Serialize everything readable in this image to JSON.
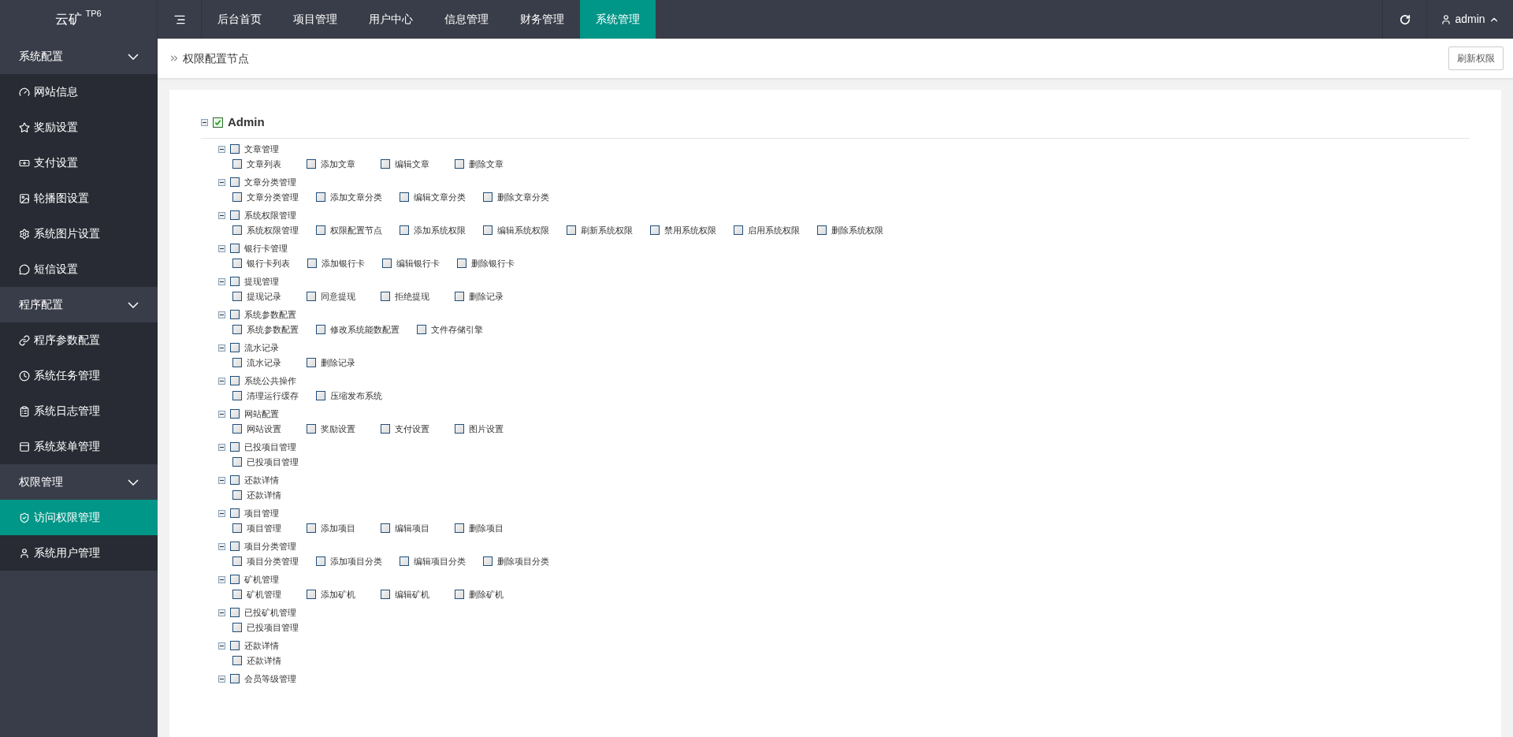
{
  "logo": {
    "name": "云矿",
    "sup": "TP6"
  },
  "top_nav": {
    "tabs": [
      {
        "label": "后台首页",
        "selected": false
      },
      {
        "label": "项目管理",
        "selected": false
      },
      {
        "label": "用户中心",
        "selected": false
      },
      {
        "label": "信息管理",
        "selected": false
      },
      {
        "label": "财务管理",
        "selected": false
      },
      {
        "label": "系统管理",
        "selected": true
      }
    ],
    "user": "admin"
  },
  "sidebar": {
    "sections": [
      {
        "title": "系统配置",
        "expanded": true,
        "items": [
          {
            "label": "网站信息",
            "selected": false
          },
          {
            "label": "奖励设置",
            "selected": false
          },
          {
            "label": "支付设置",
            "selected": false
          },
          {
            "label": "轮播图设置",
            "selected": false
          },
          {
            "label": "系统图片设置",
            "selected": false
          },
          {
            "label": "短信设置",
            "selected": false
          }
        ]
      },
      {
        "title": "程序配置",
        "expanded": true,
        "items": [
          {
            "label": "程序参数配置",
            "selected": false
          },
          {
            "label": "系统任务管理",
            "selected": false
          },
          {
            "label": "系统日志管理",
            "selected": false
          },
          {
            "label": "系统菜单管理",
            "selected": false
          }
        ]
      },
      {
        "title": "权限管理",
        "expanded": true,
        "items": [
          {
            "label": "访问权限管理",
            "selected": true
          },
          {
            "label": "系统用户管理",
            "selected": false
          }
        ]
      }
    ]
  },
  "breadcrumb": "权限配置节点",
  "refresh_button": "刷新权限",
  "tree": {
    "label": "Admin",
    "checked": true,
    "expanded": true,
    "children": [
      {
        "label": "文章管理",
        "checked": false,
        "expanded": true,
        "children": [
          {
            "label": "文章列表",
            "checked": false
          },
          {
            "label": "添加文章",
            "checked": false
          },
          {
            "label": "编辑文章",
            "checked": false
          },
          {
            "label": "删除文章",
            "checked": false
          }
        ]
      },
      {
        "label": "文章分类管理",
        "checked": false,
        "expanded": true,
        "children": [
          {
            "label": "文章分类管理",
            "checked": false
          },
          {
            "label": "添加文章分类",
            "checked": false
          },
          {
            "label": "编辑文章分类",
            "checked": false
          },
          {
            "label": "删除文章分类",
            "checked": false
          }
        ]
      },
      {
        "label": "系统权限管理",
        "checked": false,
        "expanded": true,
        "children": [
          {
            "label": "系统权限管理",
            "checked": false
          },
          {
            "label": "权限配置节点",
            "checked": false
          },
          {
            "label": "添加系统权限",
            "checked": false
          },
          {
            "label": "编辑系统权限",
            "checked": false
          },
          {
            "label": "刷新系统权限",
            "checked": false
          },
          {
            "label": "禁用系统权限",
            "checked": false
          },
          {
            "label": "启用系统权限",
            "checked": false
          },
          {
            "label": "删除系统权限",
            "checked": false
          }
        ]
      },
      {
        "label": "银行卡管理",
        "checked": false,
        "expanded": true,
        "children": [
          {
            "label": "银行卡列表",
            "checked": false
          },
          {
            "label": "添加银行卡",
            "checked": false
          },
          {
            "label": "编辑银行卡",
            "checked": false
          },
          {
            "label": "删除银行卡",
            "checked": false
          }
        ]
      },
      {
        "label": "提现管理",
        "checked": false,
        "expanded": true,
        "children": [
          {
            "label": "提现记录",
            "checked": false
          },
          {
            "label": "同意提现",
            "checked": false
          },
          {
            "label": "拒绝提现",
            "checked": false
          },
          {
            "label": "删除记录",
            "checked": false
          }
        ]
      },
      {
        "label": "系统参数配置",
        "checked": false,
        "expanded": true,
        "children": [
          {
            "label": "系统参数配置",
            "checked": false
          },
          {
            "label": "修改系统能数配置",
            "checked": false
          },
          {
            "label": "文件存储引擎",
            "checked": false
          }
        ]
      },
      {
        "label": "流水记录",
        "checked": false,
        "expanded": true,
        "children": [
          {
            "label": "流水记录",
            "checked": false
          },
          {
            "label": "删除记录",
            "checked": false
          }
        ]
      },
      {
        "label": "系统公共操作",
        "checked": false,
        "expanded": true,
        "children": [
          {
            "label": "清理运行缓存",
            "checked": false
          },
          {
            "label": "压缩发布系统",
            "checked": false
          }
        ]
      },
      {
        "label": "网站配置",
        "checked": false,
        "expanded": true,
        "children": [
          {
            "label": "网站设置",
            "checked": false
          },
          {
            "label": "奖励设置",
            "checked": false
          },
          {
            "label": "支付设置",
            "checked": false
          },
          {
            "label": "图片设置",
            "checked": false
          }
        ]
      },
      {
        "label": "已投项目管理",
        "checked": false,
        "expanded": true,
        "children": [
          {
            "label": "已投项目管理",
            "checked": false
          }
        ]
      },
      {
        "label": "还款详情",
        "checked": false,
        "expanded": true,
        "children": [
          {
            "label": "还款详情",
            "checked": false
          }
        ]
      },
      {
        "label": "项目管理",
        "checked": false,
        "expanded": true,
        "children": [
          {
            "label": "项目管理",
            "checked": false
          },
          {
            "label": "添加项目",
            "checked": false
          },
          {
            "label": "编辑项目",
            "checked": false
          },
          {
            "label": "删除项目",
            "checked": false
          }
        ]
      },
      {
        "label": "项目分类管理",
        "checked": false,
        "expanded": true,
        "children": [
          {
            "label": "项目分类管理",
            "checked": false
          },
          {
            "label": "添加项目分类",
            "checked": false
          },
          {
            "label": "编辑项目分类",
            "checked": false
          },
          {
            "label": "删除项目分类",
            "checked": false
          }
        ]
      },
      {
        "label": "矿机管理",
        "checked": false,
        "expanded": true,
        "children": [
          {
            "label": "矿机管理",
            "checked": false
          },
          {
            "label": "添加矿机",
            "checked": false
          },
          {
            "label": "编辑矿机",
            "checked": false
          },
          {
            "label": "删除矿机",
            "checked": false
          }
        ]
      },
      {
        "label": "已投矿机管理",
        "checked": false,
        "expanded": true,
        "children": [
          {
            "label": "已投项目管理",
            "checked": false
          }
        ]
      },
      {
        "label": "还款详情",
        "checked": false,
        "expanded": true,
        "children": [
          {
            "label": "还款详情",
            "checked": false
          }
        ]
      },
      {
        "label": "会员等级管理",
        "checked": false,
        "expanded": true
      }
    ]
  }
}
